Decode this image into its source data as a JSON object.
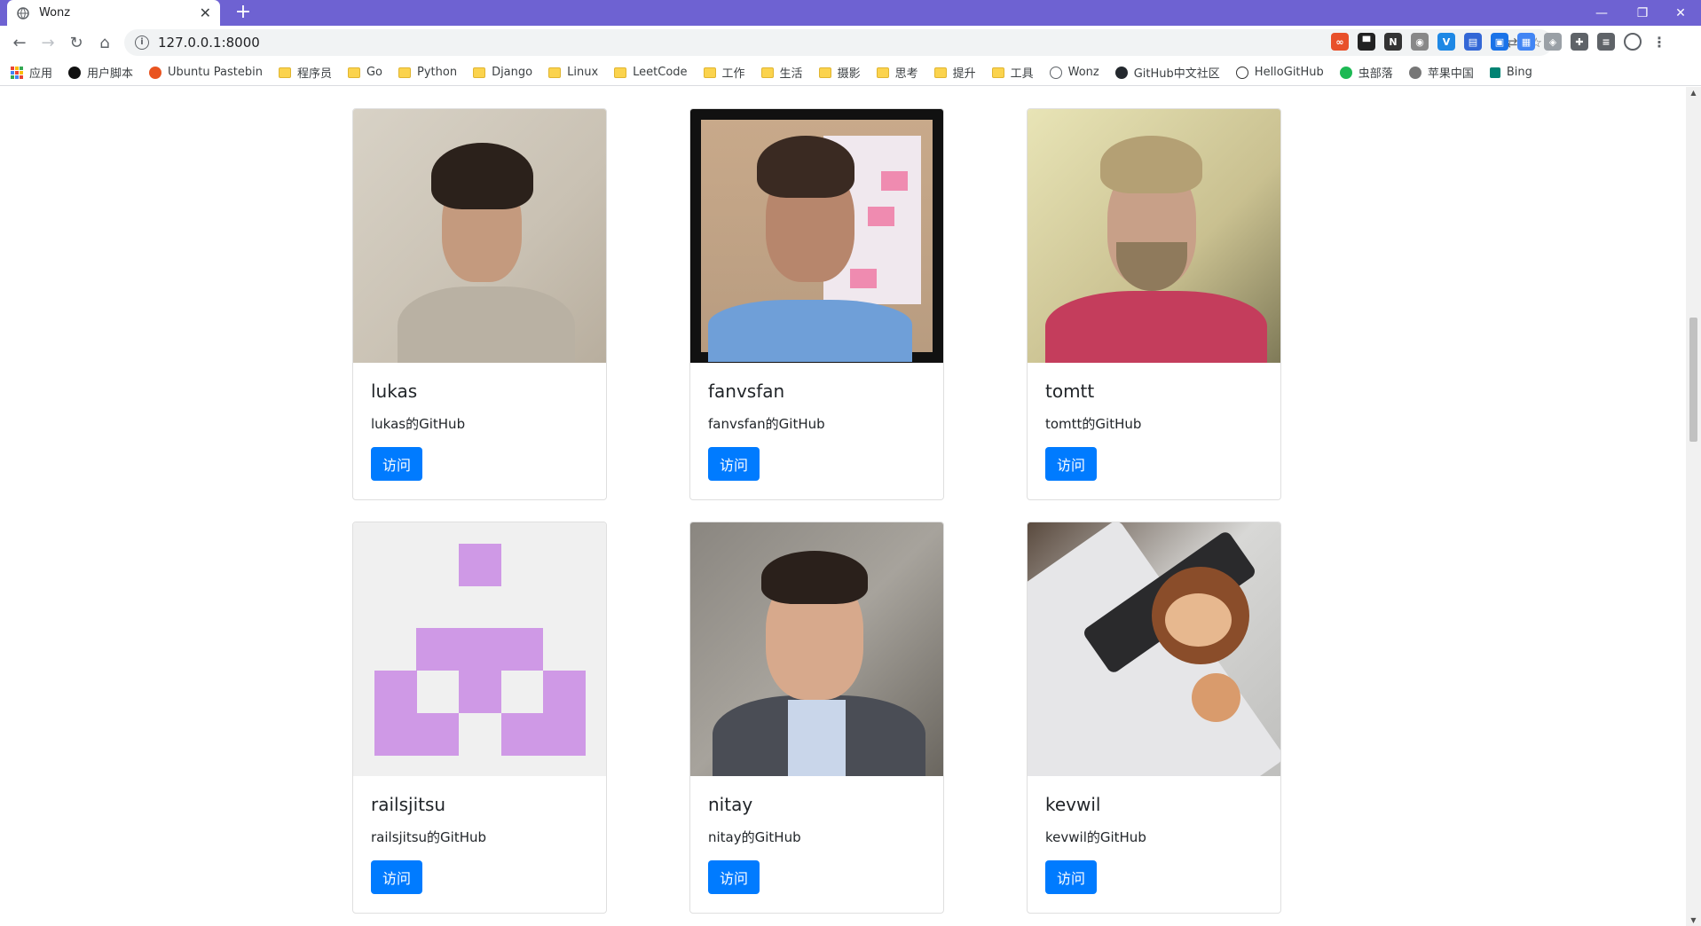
{
  "browser": {
    "tab_title": "Wonz",
    "new_tab": "+",
    "url": "127.0.0.1:8000",
    "bookmarks": [
      {
        "label": "应用",
        "icon": "apps-icon"
      },
      {
        "label": "用户脚本",
        "icon": "userscript-icon"
      },
      {
        "label": "Ubuntu Pastebin",
        "icon": "ubuntu-icon"
      },
      {
        "label": "程序员",
        "icon": "folder-icon"
      },
      {
        "label": "Go",
        "icon": "folder-icon"
      },
      {
        "label": "Python",
        "icon": "folder-icon"
      },
      {
        "label": "Django",
        "icon": "folder-icon"
      },
      {
        "label": "Linux",
        "icon": "folder-icon"
      },
      {
        "label": "LeetCode",
        "icon": "folder-icon"
      },
      {
        "label": "工作",
        "icon": "folder-icon"
      },
      {
        "label": "生活",
        "icon": "folder-icon"
      },
      {
        "label": "摄影",
        "icon": "folder-icon"
      },
      {
        "label": "思考",
        "icon": "folder-icon"
      },
      {
        "label": "提升",
        "icon": "folder-icon"
      },
      {
        "label": "工具",
        "icon": "folder-icon"
      },
      {
        "label": "Wonz",
        "icon": "globe-icon"
      },
      {
        "label": "GitHub中文社区",
        "icon": "github-icon"
      },
      {
        "label": "HelloGitHub",
        "icon": "hellogithub-icon"
      },
      {
        "label": "虫部落",
        "icon": "chongbuluo-icon"
      },
      {
        "label": "苹果中国",
        "icon": "apple-icon"
      },
      {
        "label": "Bing",
        "icon": "bing-icon"
      }
    ]
  },
  "cards": [
    {
      "name": "lukas",
      "desc": "lukas的GitHub",
      "button": "访问"
    },
    {
      "name": "fanvsfan",
      "desc": "fanvsfan的GitHub",
      "button": "访问"
    },
    {
      "name": "tomtt",
      "desc": "tomtt的GitHub",
      "button": "访问"
    },
    {
      "name": "railsjitsu",
      "desc": "railsjitsu的GitHub",
      "button": "访问"
    },
    {
      "name": "nitay",
      "desc": "nitay的GitHub",
      "button": "访问"
    },
    {
      "name": "kevwil",
      "desc": "kevwil的GitHub",
      "button": "访问"
    }
  ],
  "colors": {
    "titlebar": "#6e62d2",
    "button": "#007bff",
    "identicon": "#cf99e6"
  }
}
